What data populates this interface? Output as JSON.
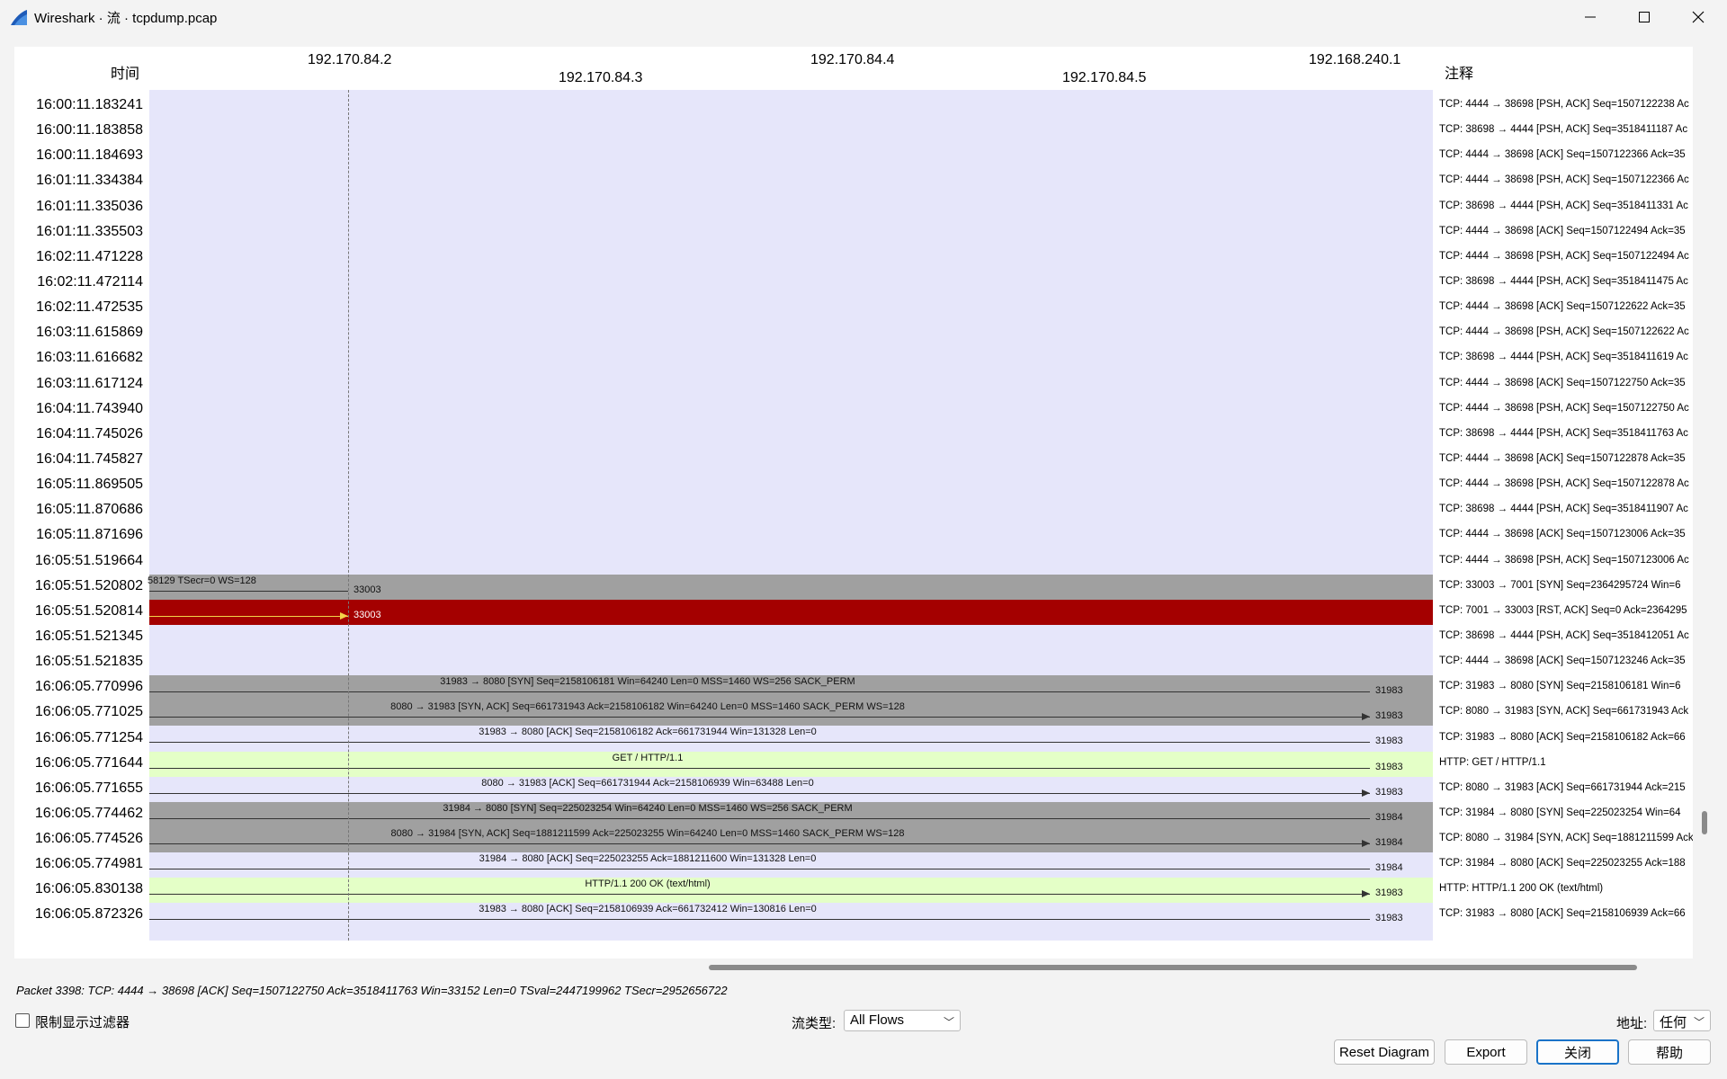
{
  "window": {
    "title": "Wireshark · 流 · tcpdump.pcap"
  },
  "header": {
    "time_label": "时间",
    "comment_label": "注释",
    "hosts": [
      "192.170.84.2",
      "192.170.84.3",
      "192.170.84.4",
      "192.170.84.5",
      "192.168.240.1"
    ]
  },
  "rows": [
    {
      "time": "16:00:11.183241",
      "comment": "TCP: 4444 → 38698 [PSH, ACK] Seq=1507122238 Ac",
      "style": "plain"
    },
    {
      "time": "16:00:11.183858",
      "comment": "TCP: 38698 → 4444 [PSH, ACK] Seq=3518411187 Ac",
      "style": "plain"
    },
    {
      "time": "16:00:11.184693",
      "comment": "TCP: 4444 → 38698 [ACK] Seq=1507122366 Ack=35",
      "style": "plain"
    },
    {
      "time": "16:01:11.334384",
      "comment": "TCP: 4444 → 38698 [PSH, ACK] Seq=1507122366 Ac",
      "style": "plain"
    },
    {
      "time": "16:01:11.335036",
      "comment": "TCP: 38698 → 4444 [PSH, ACK] Seq=3518411331 Ac",
      "style": "plain"
    },
    {
      "time": "16:01:11.335503",
      "comment": "TCP: 4444 → 38698 [ACK] Seq=1507122494 Ack=35",
      "style": "plain"
    },
    {
      "time": "16:02:11.471228",
      "comment": "TCP: 4444 → 38698 [PSH, ACK] Seq=1507122494 Ac",
      "style": "plain"
    },
    {
      "time": "16:02:11.472114",
      "comment": "TCP: 38698 → 4444 [PSH, ACK] Seq=3518411475 Ac",
      "style": "plain"
    },
    {
      "time": "16:02:11.472535",
      "comment": "TCP: 4444 → 38698 [ACK] Seq=1507122622 Ack=35",
      "style": "plain"
    },
    {
      "time": "16:03:11.615869",
      "comment": "TCP: 4444 → 38698 [PSH, ACK] Seq=1507122622 Ac",
      "style": "plain"
    },
    {
      "time": "16:03:11.616682",
      "comment": "TCP: 38698 → 4444 [PSH, ACK] Seq=3518411619 Ac",
      "style": "plain"
    },
    {
      "time": "16:03:11.617124",
      "comment": "TCP: 4444 → 38698 [ACK] Seq=1507122750 Ack=35",
      "style": "plain"
    },
    {
      "time": "16:04:11.743940",
      "comment": "TCP: 4444 → 38698 [PSH, ACK] Seq=1507122750 Ac",
      "style": "plain"
    },
    {
      "time": "16:04:11.745026",
      "comment": "TCP: 38698 → 4444 [PSH, ACK] Seq=3518411763 Ac",
      "style": "plain"
    },
    {
      "time": "16:04:11.745827",
      "comment": "TCP: 4444 → 38698 [ACK] Seq=1507122878 Ack=35",
      "style": "plain"
    },
    {
      "time": "16:05:11.869505",
      "comment": "TCP: 4444 → 38698 [PSH, ACK] Seq=1507122878 Ac",
      "style": "plain"
    },
    {
      "time": "16:05:11.870686",
      "comment": "TCP: 38698 → 4444 [PSH, ACK] Seq=3518411907 Ac",
      "style": "plain"
    },
    {
      "time": "16:05:11.871696",
      "comment": "TCP: 4444 → 38698 [ACK] Seq=1507123006 Ack=35",
      "style": "plain"
    },
    {
      "time": "16:05:51.519664",
      "comment": "TCP: 4444 → 38698 [PSH, ACK] Seq=1507123006 Ac",
      "style": "plain"
    },
    {
      "time": "16:05:51.520802",
      "comment": "TCP: 33003 → 7001 [SYN] Seq=2364295724 Win=6",
      "style": "gray",
      "label": "58129 TSecr=0 WS=128",
      "port": "33003"
    },
    {
      "time": "16:05:51.520814",
      "comment": "TCP: 7001 → 33003 [RST, ACK] Seq=0 Ack=2364295",
      "style": "red",
      "port": "33003"
    },
    {
      "time": "16:05:51.521345",
      "comment": "TCP: 38698 → 4444 [PSH, ACK] Seq=3518412051 Ac",
      "style": "plain"
    },
    {
      "time": "16:05:51.521835",
      "comment": "TCP: 4444 → 38698 [ACK] Seq=1507123246 Ack=35",
      "style": "plain"
    },
    {
      "time": "16:06:05.770996",
      "comment": "TCP: 31983 → 8080 [SYN] Seq=2158106181 Win=6",
      "style": "gray",
      "label": "31983 → 8080 [SYN] Seq=2158106181 Win=64240 Len=0 MSS=1460 WS=256 SACK_PERM",
      "port": "31983",
      "dir": "left"
    },
    {
      "time": "16:06:05.771025",
      "comment": "TCP: 8080 → 31983 [SYN, ACK] Seq=661731943 Ack",
      "style": "gray",
      "label": "8080 → 31983 [SYN, ACK] Seq=661731943 Ack=2158106182 Win=64240 Len=0 MSS=1460 SACK_PERM WS=128",
      "port": "31983",
      "dir": "right"
    },
    {
      "time": "16:06:05.771254",
      "comment": "TCP: 31983 → 8080 [ACK] Seq=2158106182 Ack=66",
      "style": "plain",
      "label": "31983 → 8080 [ACK] Seq=2158106182 Ack=661731944 Win=131328 Len=0",
      "port": "31983",
      "dir": "left"
    },
    {
      "time": "16:06:05.771644",
      "comment": "HTTP: GET / HTTP/1.1",
      "style": "green",
      "label": "GET / HTTP/1.1",
      "port": "31983",
      "dir": "left"
    },
    {
      "time": "16:06:05.771655",
      "comment": "TCP: 8080 → 31983 [ACK] Seq=661731944 Ack=215",
      "style": "plain",
      "label": "8080 → 31983 [ACK] Seq=661731944 Ack=2158106939 Win=63488 Len=0",
      "port": "31983",
      "dir": "right"
    },
    {
      "time": "16:06:05.774462",
      "comment": "TCP: 31984 → 8080 [SYN] Seq=225023254 Win=64",
      "style": "gray",
      "label": "31984 → 8080 [SYN] Seq=225023254 Win=64240 Len=0 MSS=1460 WS=256 SACK_PERM",
      "port": "31984",
      "dir": "left"
    },
    {
      "time": "16:06:05.774526",
      "comment": "TCP: 8080 → 31984 [SYN, ACK] Seq=1881211599 Ack",
      "style": "gray",
      "label": "8080 → 31984 [SYN, ACK] Seq=1881211599 Ack=225023255 Win=64240 Len=0 MSS=1460 SACK_PERM WS=128",
      "port": "31984",
      "dir": "right"
    },
    {
      "time": "16:06:05.774981",
      "comment": "TCP: 31984 → 8080 [ACK] Seq=225023255 Ack=188",
      "style": "plain",
      "label": "31984 → 8080 [ACK] Seq=225023255 Ack=1881211600 Win=131328 Len=0",
      "port": "31984",
      "dir": "left"
    },
    {
      "time": "16:06:05.830138",
      "comment": "HTTP: HTTP/1.1 200 OK  (text/html)",
      "style": "green",
      "label": "HTTP/1.1 200 OK  (text/html)",
      "port": "31983",
      "dir": "right"
    },
    {
      "time": "16:06:05.872326",
      "comment": "TCP: 31983 → 8080 [ACK] Seq=2158106939 Ack=66",
      "style": "plain",
      "label": "31983 → 8080 [ACK] Seq=2158106939 Ack=661732412 Win=130816 Len=0",
      "port": "31983",
      "dir": "left"
    }
  ],
  "status": {
    "text": "Packet 3398: TCP: 4444 → 38698 [ACK] Seq=1507122750 Ack=3518411763 Win=33152 Len=0 TSval=2447199962 TSecr=2952656722"
  },
  "controls": {
    "limit_filter_label": "限制显示过滤器",
    "limit_filter_checked": false,
    "flow_type_label": "流类型:",
    "flow_type_value": "All Flows",
    "address_label": "地址:",
    "address_value": "任何"
  },
  "buttons": {
    "reset": "Reset Diagram",
    "export": "Export",
    "close": "关闭",
    "help": "帮助"
  },
  "colors": {
    "lane_bg": "#e6e6fa",
    "gray_row": "#a0a0a0",
    "red_row": "#a40000",
    "green_row": "#e4ffc7",
    "accent": "#1a73c8"
  }
}
